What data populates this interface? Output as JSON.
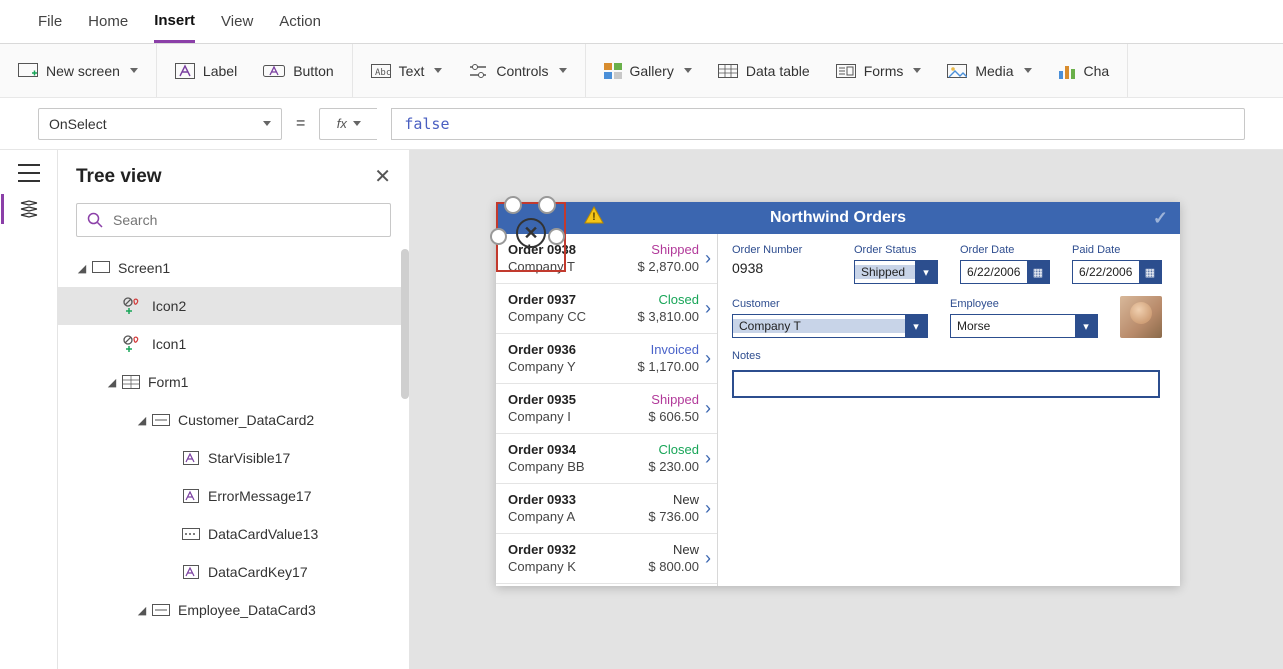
{
  "menu": {
    "items": [
      "File",
      "Home",
      "Insert",
      "View",
      "Action"
    ],
    "active": "Insert"
  },
  "ribbon": {
    "newScreen": "New screen",
    "label": "Label",
    "button": "Button",
    "text": "Text",
    "controls": "Controls",
    "gallery": "Gallery",
    "dataTable": "Data table",
    "forms": "Forms",
    "media": "Media",
    "charts": "Cha"
  },
  "formula": {
    "property": "OnSelect",
    "fx": "fx",
    "value": "false"
  },
  "tree": {
    "title": "Tree view",
    "searchPlaceholder": "Search",
    "nodes": {
      "screen1": "Screen1",
      "icon2": "Icon2",
      "icon1": "Icon1",
      "form1": "Form1",
      "customerCard": "Customer_DataCard2",
      "starVisible": "StarVisible17",
      "errorMessage": "ErrorMessage17",
      "dataCardValue": "DataCardValue13",
      "dataCardKey": "DataCardKey17",
      "employeeCard": "Employee_DataCard3"
    }
  },
  "canvasApp": {
    "title": "Northwind Orders",
    "orders": [
      {
        "num": "Order 0938",
        "company": "Company T",
        "status": "Shipped",
        "statusColor": "#B23A9A",
        "amount": "$ 2,870.00"
      },
      {
        "num": "Order 0937",
        "company": "Company CC",
        "status": "Closed",
        "statusColor": "#18A558",
        "amount": "$ 3,810.00"
      },
      {
        "num": "Order 0936",
        "company": "Company Y",
        "status": "Invoiced",
        "statusColor": "#4A63C9",
        "amount": "$ 1,170.00"
      },
      {
        "num": "Order 0935",
        "company": "Company I",
        "status": "Shipped",
        "statusColor": "#B23A9A",
        "amount": "$ 606.50"
      },
      {
        "num": "Order 0934",
        "company": "Company BB",
        "status": "Closed",
        "statusColor": "#18A558",
        "amount": "$ 230.00"
      },
      {
        "num": "Order 0933",
        "company": "Company A",
        "status": "New",
        "statusColor": "#333333",
        "amount": "$ 736.00"
      },
      {
        "num": "Order 0932",
        "company": "Company K",
        "status": "New",
        "statusColor": "#333333",
        "amount": "$ 800.00"
      }
    ],
    "detail": {
      "labels": {
        "orderNumber": "Order Number",
        "orderStatus": "Order Status",
        "orderDate": "Order Date",
        "paidDate": "Paid Date",
        "customer": "Customer",
        "employee": "Employee",
        "notes": "Notes"
      },
      "orderNumber": "0938",
      "orderStatus": "Shipped",
      "orderDate": "6/22/2006",
      "paidDate": "6/22/2006",
      "customer": "Company T",
      "employee": "Morse"
    }
  }
}
